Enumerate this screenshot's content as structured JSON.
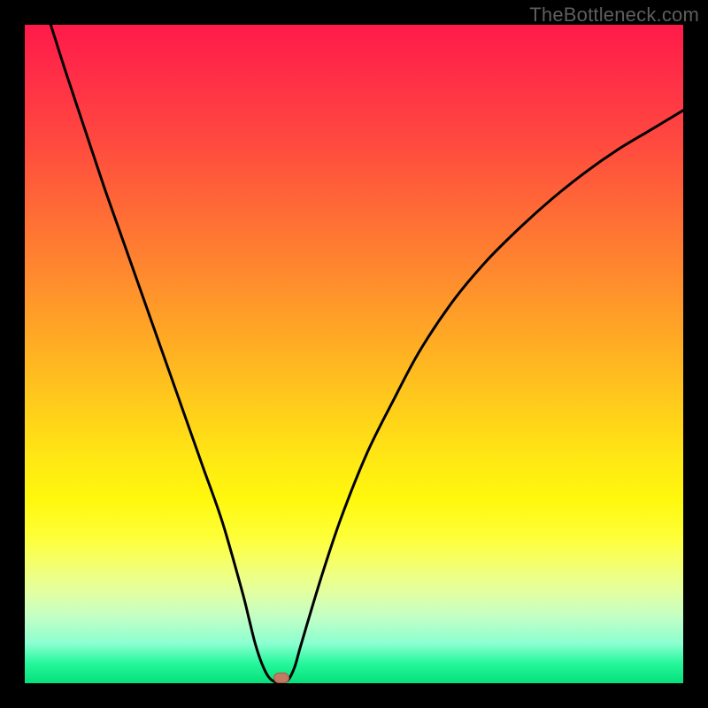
{
  "watermark": "TheBottleneck.com",
  "colors": {
    "frame": "#000000",
    "curve": "#000000",
    "marker_fill": "#c17a63",
    "marker_border": "#a85a46"
  },
  "chart_data": {
    "type": "line",
    "title": "",
    "xlabel": "",
    "ylabel": "",
    "xlim": [
      0,
      100
    ],
    "ylim": [
      0,
      100
    ],
    "grid": false,
    "legend": false,
    "series": [
      {
        "name": "bottleneck-curve",
        "x": [
          0,
          3,
          6,
          9,
          12,
          15,
          18,
          21,
          24,
          27,
          30,
          33,
          34,
          35,
          36,
          37,
          38,
          39,
          40,
          41,
          42,
          45,
          48,
          52,
          56,
          60,
          65,
          70,
          75,
          80,
          85,
          90,
          95,
          100
        ],
        "y": [
          113,
          103,
          93.5,
          84.5,
          75.5,
          67,
          58.5,
          50,
          41.5,
          33,
          24.5,
          14,
          10,
          6,
          3,
          1,
          0.2,
          0.2,
          0.5,
          2.5,
          6,
          16,
          25,
          35,
          43,
          50.5,
          58,
          64,
          69,
          73.5,
          77.5,
          81,
          84,
          87
        ]
      }
    ],
    "marker": {
      "x": 39,
      "y": 0.8
    },
    "gradient_stops": [
      {
        "pos": 0,
        "color": "#ff1a49"
      },
      {
        "pos": 8,
        "color": "#ff2f47"
      },
      {
        "pos": 18,
        "color": "#ff4a3f"
      },
      {
        "pos": 28,
        "color": "#ff6a36"
      },
      {
        "pos": 38,
        "color": "#ff8a2e"
      },
      {
        "pos": 48,
        "color": "#ffab24"
      },
      {
        "pos": 58,
        "color": "#ffcd1b"
      },
      {
        "pos": 66,
        "color": "#ffe814"
      },
      {
        "pos": 72,
        "color": "#fff80d"
      },
      {
        "pos": 78,
        "color": "#feff3a"
      },
      {
        "pos": 82,
        "color": "#f4ff6f"
      },
      {
        "pos": 86,
        "color": "#e4ffa0"
      },
      {
        "pos": 90,
        "color": "#c2ffc6"
      },
      {
        "pos": 94,
        "color": "#8affd0"
      },
      {
        "pos": 97,
        "color": "#25f79b"
      },
      {
        "pos": 100,
        "color": "#06e07a"
      }
    ]
  }
}
